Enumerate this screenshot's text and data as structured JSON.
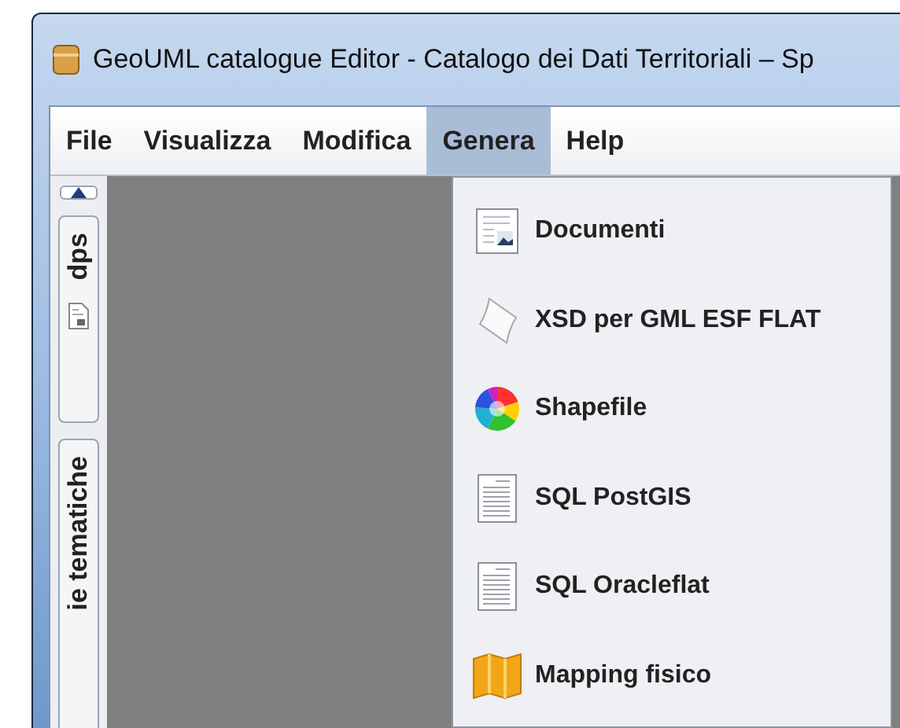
{
  "window": {
    "title": "GeoUML catalogue Editor - Catalogo dei Dati Territoriali – Sp"
  },
  "menu_bar": [
    {
      "label": "File",
      "selected": false
    },
    {
      "label": "Visualizza",
      "selected": false
    },
    {
      "label": "Modifica",
      "selected": false
    },
    {
      "label": "Genera",
      "selected": true
    },
    {
      "label": "Help",
      "selected": false
    }
  ],
  "side_tabs": [
    {
      "label": "dps"
    },
    {
      "label": "ie tematiche"
    }
  ],
  "genera_menu": [
    {
      "label": "Documenti"
    },
    {
      "label": "XSD per GML ESF FLAT"
    },
    {
      "label": "Shapefile"
    },
    {
      "label": "SQL PostGIS"
    },
    {
      "label": "SQL Oracleflat"
    },
    {
      "label": "Mapping fisico"
    }
  ]
}
